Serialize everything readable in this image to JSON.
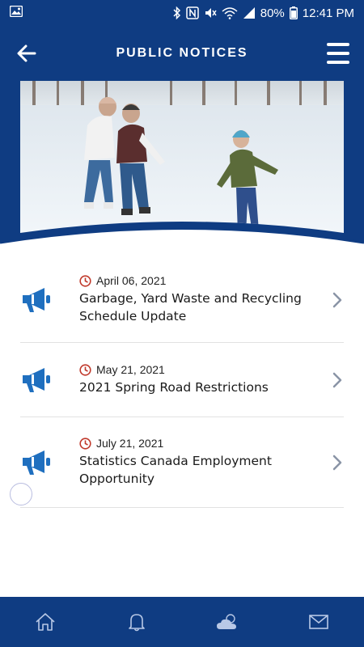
{
  "status_bar": {
    "battery": "80%",
    "time": "12:41 PM"
  },
  "header": {
    "title": "PUBLIC NOTICES"
  },
  "notices": [
    {
      "date": "April 06, 2021",
      "title": "Garbage, Yard Waste and Recycling Schedule Update"
    },
    {
      "date": "May 21, 2021",
      "title": "2021 Spring Road Restrictions"
    },
    {
      "date": "July 21, 2021",
      "title": "Statistics Canada Employment Opportunity"
    }
  ],
  "icons": {
    "notice_icon": "megaphone-icon",
    "date_icon": "clock-icon",
    "row_action": "chevron-right-icon"
  },
  "bottom_nav": [
    "home-icon",
    "bell-icon",
    "weather-icon",
    "mail-icon"
  ],
  "colors": {
    "brand_blue": "#0f3c82",
    "accent_blue": "#1f6fbf",
    "date_icon_red": "#c0392b",
    "chevron_gray": "#8a94a6"
  }
}
